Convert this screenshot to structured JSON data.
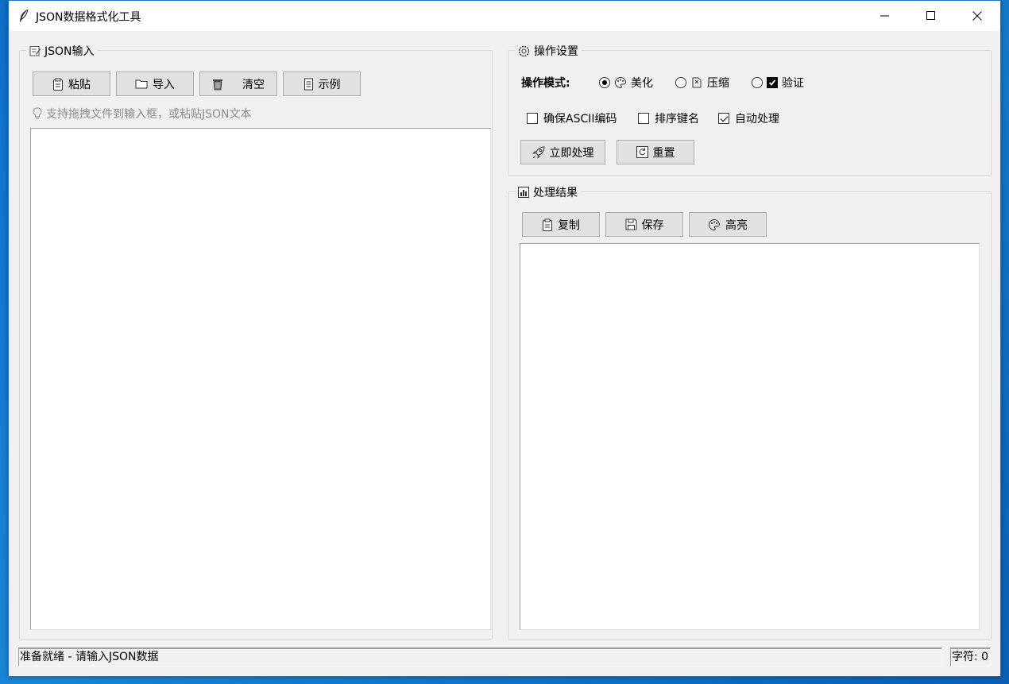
{
  "window": {
    "title": "JSON数据格式化工具"
  },
  "input_panel": {
    "legend": "JSON输入",
    "buttons": {
      "paste": "粘贴",
      "import": "导入",
      "clear": "清空",
      "example": "示例"
    },
    "hint": "支持拖拽文件到输入框，或粘贴JSON文本",
    "text": ""
  },
  "settings_panel": {
    "legend": "操作设置",
    "mode_label": "操作模式:",
    "modes": {
      "beautify": "美化",
      "compress": "压缩",
      "validate": "验证"
    },
    "selected_mode": "美化",
    "options": {
      "ensure_ascii": "确保ASCII编码",
      "sort_keys": "排序键名",
      "auto_process": "自动处理"
    },
    "option_states": {
      "ensure_ascii": false,
      "sort_keys": false,
      "auto_process": true
    },
    "buttons": {
      "process": "立即处理",
      "reset": "重置"
    }
  },
  "result_panel": {
    "legend": "处理结果",
    "buttons": {
      "copy": "复制",
      "save": "保存",
      "highlight": "高亮"
    },
    "text": ""
  },
  "status": {
    "message": "准备就绪 - 请输入JSON数据",
    "char_count": "字符: 0"
  }
}
